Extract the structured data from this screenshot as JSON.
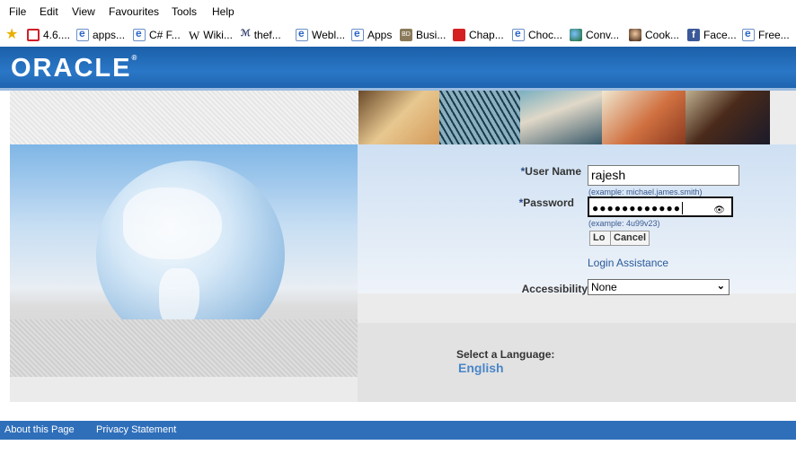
{
  "menu": [
    "File",
    "Edit",
    "View",
    "Favourites",
    "Tools",
    "Help"
  ],
  "favourites": [
    {
      "label": "4.6....",
      "icon": "oracle-icon"
    },
    {
      "label": "apps...",
      "icon": "ie-page-icon"
    },
    {
      "label": "C# F...",
      "icon": "ie-page-icon"
    },
    {
      "label": "Wiki...",
      "icon": "wikipedia-icon"
    },
    {
      "label": "thef...",
      "icon": "thefreedictionary-icon"
    },
    {
      "label": "Webl...",
      "icon": "ie-page-icon"
    },
    {
      "label": "Apps",
      "icon": "ie-page-icon"
    },
    {
      "label": "Busi...",
      "icon": "bd-icon"
    },
    {
      "label": "Chap...",
      "icon": "chap-icon"
    },
    {
      "label": "Choc...",
      "icon": "ie-page-icon"
    },
    {
      "label": "Conv...",
      "icon": "globe-icon"
    },
    {
      "label": "Cook...",
      "icon": "avatar-icon"
    },
    {
      "label": "Face...",
      "icon": "facebook-icon"
    },
    {
      "label": "Free...",
      "icon": "ie-page-icon"
    }
  ],
  "header": {
    "logo": "ORACLE",
    "logo_mark": "®"
  },
  "login": {
    "username_label": "User Name",
    "username_value": "rajesh",
    "username_hint": "(example: michael.james.smith)",
    "password_label": "Password",
    "password_value": "●●●●●●●●●●●●",
    "password_hint": "(example: 4u99v23)",
    "required_mark": "*",
    "login_button": "Login",
    "login_button_visible": "Lo",
    "cancel_button": "Cancel",
    "assistance_link": "Login Assistance",
    "accessibility_label": "Accessibility",
    "accessibility_value": "None"
  },
  "language": {
    "label": "Select a Language:",
    "option": "English"
  },
  "footer": {
    "about": "About this Page",
    "privacy": "Privacy Statement"
  },
  "colors": {
    "header_blue": "#2a77c7",
    "footer_blue": "#2f6fba",
    "link": "#2a5a9a"
  }
}
